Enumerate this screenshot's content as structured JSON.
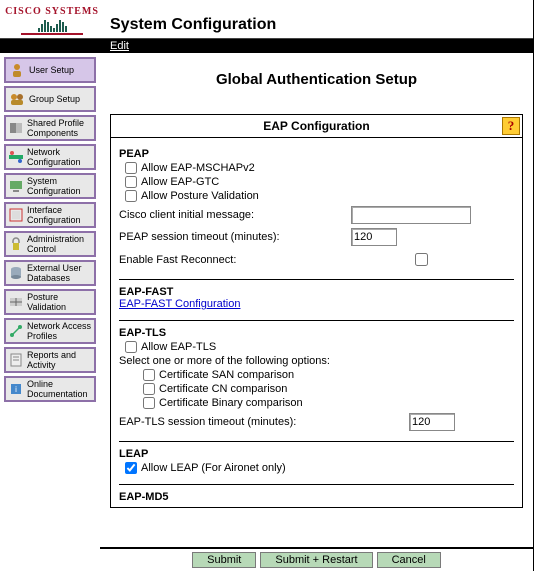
{
  "header": {
    "logo_text": "CISCO SYSTEMS",
    "title": "System Configuration",
    "edit_label": "Edit"
  },
  "sidebar": {
    "items": [
      {
        "label": "User Setup",
        "icon": "user-icon",
        "active": true
      },
      {
        "label": "Group Setup",
        "icon": "group-icon",
        "active": false
      },
      {
        "label": "Shared Profile Components",
        "icon": "shared-profile-icon",
        "active": false
      },
      {
        "label": "Network Configuration",
        "icon": "network-config-icon",
        "active": false
      },
      {
        "label": "System Configuration",
        "icon": "system-config-icon",
        "active": false
      },
      {
        "label": "Interface Configuration",
        "icon": "interface-config-icon",
        "active": false
      },
      {
        "label": "Administration Control",
        "icon": "admin-control-icon",
        "active": false
      },
      {
        "label": "External User Databases",
        "icon": "external-db-icon",
        "active": false
      },
      {
        "label": "Posture Validation",
        "icon": "posture-icon",
        "active": false
      },
      {
        "label": "Network Access Profiles",
        "icon": "nap-icon",
        "active": false
      },
      {
        "label": "Reports and Activity",
        "icon": "reports-icon",
        "active": false
      },
      {
        "label": "Online Documentation",
        "icon": "docs-icon",
        "active": false
      }
    ]
  },
  "content": {
    "heading": "Global Authentication Setup",
    "panel_title": "EAP Configuration",
    "help_glyph": "?",
    "peap": {
      "title": "PEAP",
      "allow_mschapv2": {
        "label": "Allow EAP-MSCHAPv2",
        "checked": false
      },
      "allow_gtc": {
        "label": "Allow EAP-GTC",
        "checked": false
      },
      "allow_posture": {
        "label": "Allow Posture Validation",
        "checked": false
      },
      "initial_msg_label": "Cisco client initial message:",
      "initial_msg_value": "",
      "timeout_label": "PEAP session timeout (minutes):",
      "timeout_value": "120",
      "fast_reconnect_label": "Enable Fast Reconnect:",
      "fast_reconnect_checked": false
    },
    "eap_fast": {
      "title": "EAP-FAST",
      "link_label": "EAP-FAST Configuration"
    },
    "eap_tls": {
      "title": "EAP-TLS",
      "allow": {
        "label": "Allow EAP-TLS",
        "checked": false
      },
      "options_label": "Select one or more of the following options:",
      "cert_san": {
        "label": "Certificate SAN comparison",
        "checked": false
      },
      "cert_cn": {
        "label": "Certificate CN comparison",
        "checked": false
      },
      "cert_bin": {
        "label": "Certificate Binary comparison",
        "checked": false
      },
      "timeout_label": "EAP-TLS session timeout (minutes):",
      "timeout_value": "120"
    },
    "leap": {
      "title": "LEAP",
      "allow": {
        "label": "Allow LEAP (For Aironet only)",
        "checked": true
      }
    },
    "eap_md5": {
      "title": "EAP-MD5"
    }
  },
  "footer": {
    "submit": "Submit",
    "submit_restart": "Submit + Restart",
    "cancel": "Cancel"
  }
}
